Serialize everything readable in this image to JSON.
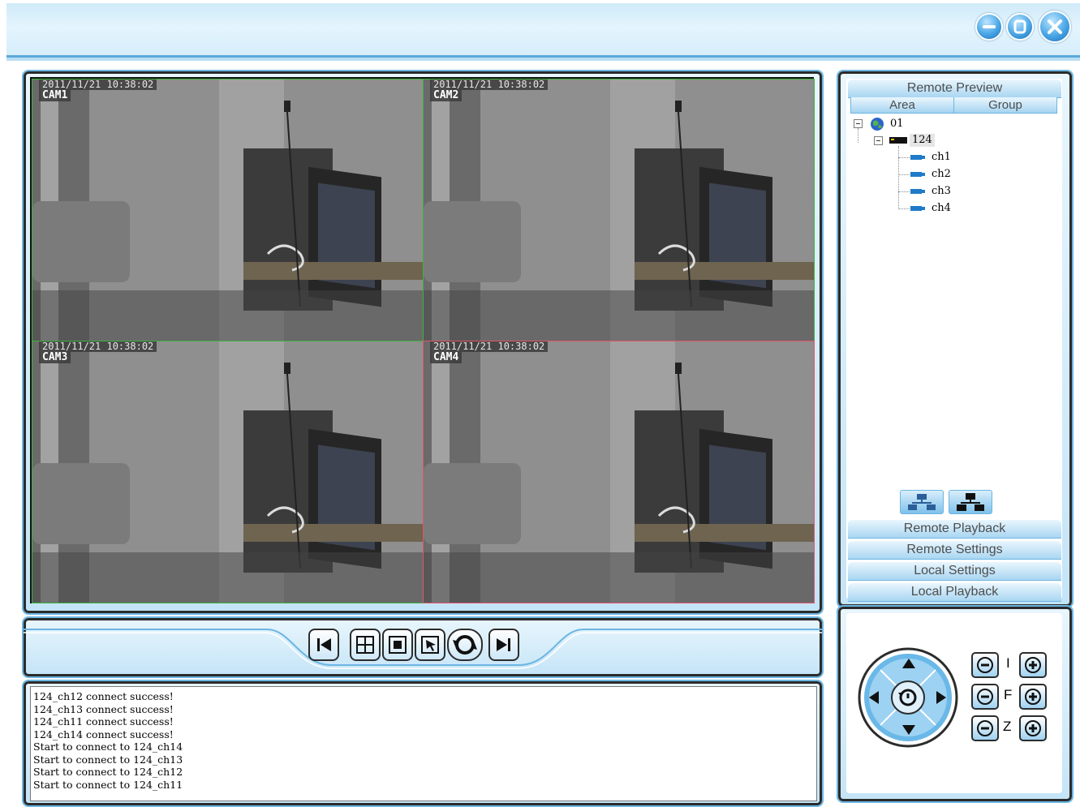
{
  "window": {
    "minimize_icon": "minimize-icon",
    "restore_icon": "restore-icon",
    "close_icon": "close-icon"
  },
  "video": {
    "cells": [
      {
        "timestamp": "2011/11/21 10:38:02",
        "camera": "CAM1",
        "border_color": "#3cb43c"
      },
      {
        "timestamp": "2011/11/21 10:38:02",
        "camera": "CAM2",
        "border_color": "#3cb43c"
      },
      {
        "timestamp": "2011/11/21 10:38:02",
        "camera": "CAM3",
        "border_color": "#3cb43c"
      },
      {
        "timestamp": "2011/11/21 10:38:02",
        "camera": "CAM4",
        "border_color": "#e2556b"
      }
    ]
  },
  "toolbar": {
    "buttons": [
      "previous-icon",
      "split-4-icon",
      "fullscreen-icon",
      "select-window-icon",
      "cycle-icon",
      "next-icon"
    ]
  },
  "log": {
    "lines": [
      "124_ch12 connect success!",
      "124_ch13 connect success!",
      "124_ch11 connect success!",
      "124_ch14 connect success!",
      "Start to connect to 124_ch14",
      "Start to connect to 124_ch13",
      "Start to connect to 124_ch12",
      "Start to connect to 124_ch11"
    ]
  },
  "sidebar": {
    "remote_preview": "Remote Preview",
    "tabs": {
      "area": "Area",
      "group": "Group"
    },
    "tree": {
      "root": "01",
      "device": "124",
      "channels": [
        "ch1",
        "ch2",
        "ch3",
        "ch4"
      ]
    },
    "sections": [
      "Remote Playback",
      "Remote Settings",
      "Local Settings",
      "Local Playback"
    ]
  },
  "ptz": {
    "iris_label": "I",
    "focus_label": "F",
    "zoom_label": "Z"
  },
  "colors": {
    "accent": "#6cb6e3",
    "panel_light": "#e9f6fd"
  }
}
